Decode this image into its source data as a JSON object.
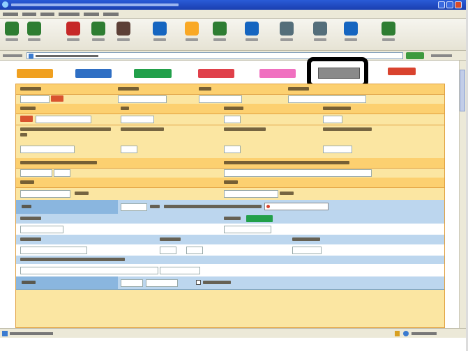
{
  "window": {
    "title": ""
  },
  "menu": [],
  "toolbar": {
    "buttons": [
      {
        "icon": "back-icon",
        "color": "#2e7d32"
      },
      {
        "icon": "forward-icon",
        "color": "#2e7d32"
      },
      {
        "icon": "stop-icon",
        "color": "#c62828"
      },
      {
        "icon": "refresh-icon",
        "color": "#2e7d32"
      },
      {
        "icon": "home-icon",
        "color": "#5d4037"
      },
      {
        "icon": "search-icon",
        "color": "#1565c0"
      },
      {
        "icon": "favorites-icon",
        "color": "#f9a825"
      },
      {
        "icon": "history-icon",
        "color": "#2e7d32"
      },
      {
        "icon": "mail-icon",
        "color": "#1565c0"
      },
      {
        "icon": "print-icon",
        "color": "#546e7a"
      },
      {
        "icon": "edit-icon",
        "color": "#546e7a"
      },
      {
        "icon": "discuss-icon",
        "color": "#1565c0"
      },
      {
        "icon": "messenger-icon",
        "color": "#2e7d32"
      }
    ]
  },
  "address": {
    "value": ""
  },
  "status": {
    "text": ""
  },
  "tabs": [
    {
      "label": "",
      "color": "#f0a020"
    },
    {
      "label": "",
      "color": "#2f6fc4"
    },
    {
      "label": "",
      "color": "#22a04a"
    },
    {
      "label": "",
      "color": "#e0404a"
    },
    {
      "label": "",
      "color": "#f070c0"
    },
    {
      "label": "",
      "color": "#8a8a8a"
    },
    {
      "label": "",
      "color": "#d9432e"
    }
  ],
  "colors": {
    "form_bg": "#fbe6a2",
    "header_bg": "#fcd070",
    "blue_row": "#bcd6ee",
    "accent_red": "#d9532e",
    "highlight_frame": "#000000"
  }
}
